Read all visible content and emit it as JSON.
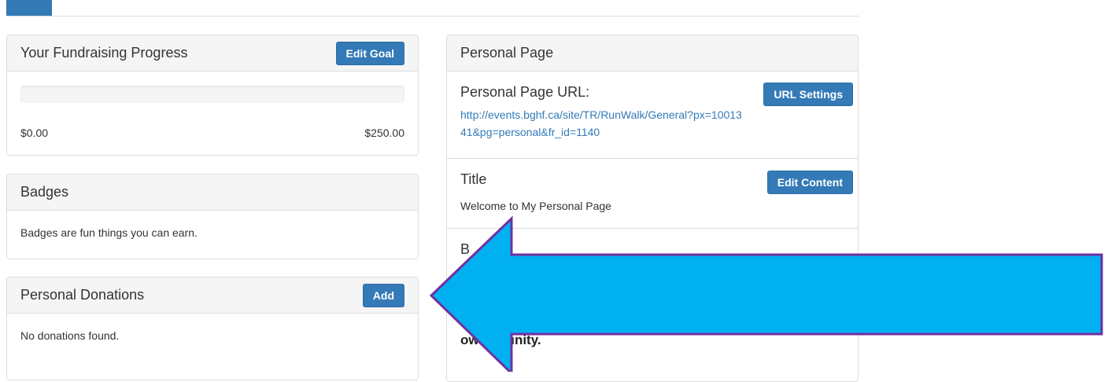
{
  "progress_panel": {
    "title": "Your Fundraising Progress",
    "edit_goal_label": "Edit Goal",
    "raised": "$0.00",
    "goal": "$250.00",
    "progress_fraction": 0
  },
  "badges_panel": {
    "title": "Badges",
    "text": "Badges are fun things you can earn."
  },
  "donations_panel": {
    "title": "Personal Donations",
    "add_label": "Add",
    "text": "No donations found."
  },
  "personal_panel": {
    "title": "Personal Page",
    "url_label": "Personal Page URL:",
    "url_settings_label": "URL Settings",
    "url": "http://events.bghf.ca/site/TR/RunWalk/General?px=1001341&pg=personal&fr_id=1140",
    "title_label": "Title",
    "edit_content_label": "Edit Content",
    "title_value": "Welcome to My Personal Page",
    "body_label_fragment": "B",
    "body_text_fragment": "ow    mmunity."
  },
  "colors": {
    "primary": "#337ab7",
    "arrow_fill": "#00b0f0",
    "arrow_stroke": "#7030a0"
  }
}
